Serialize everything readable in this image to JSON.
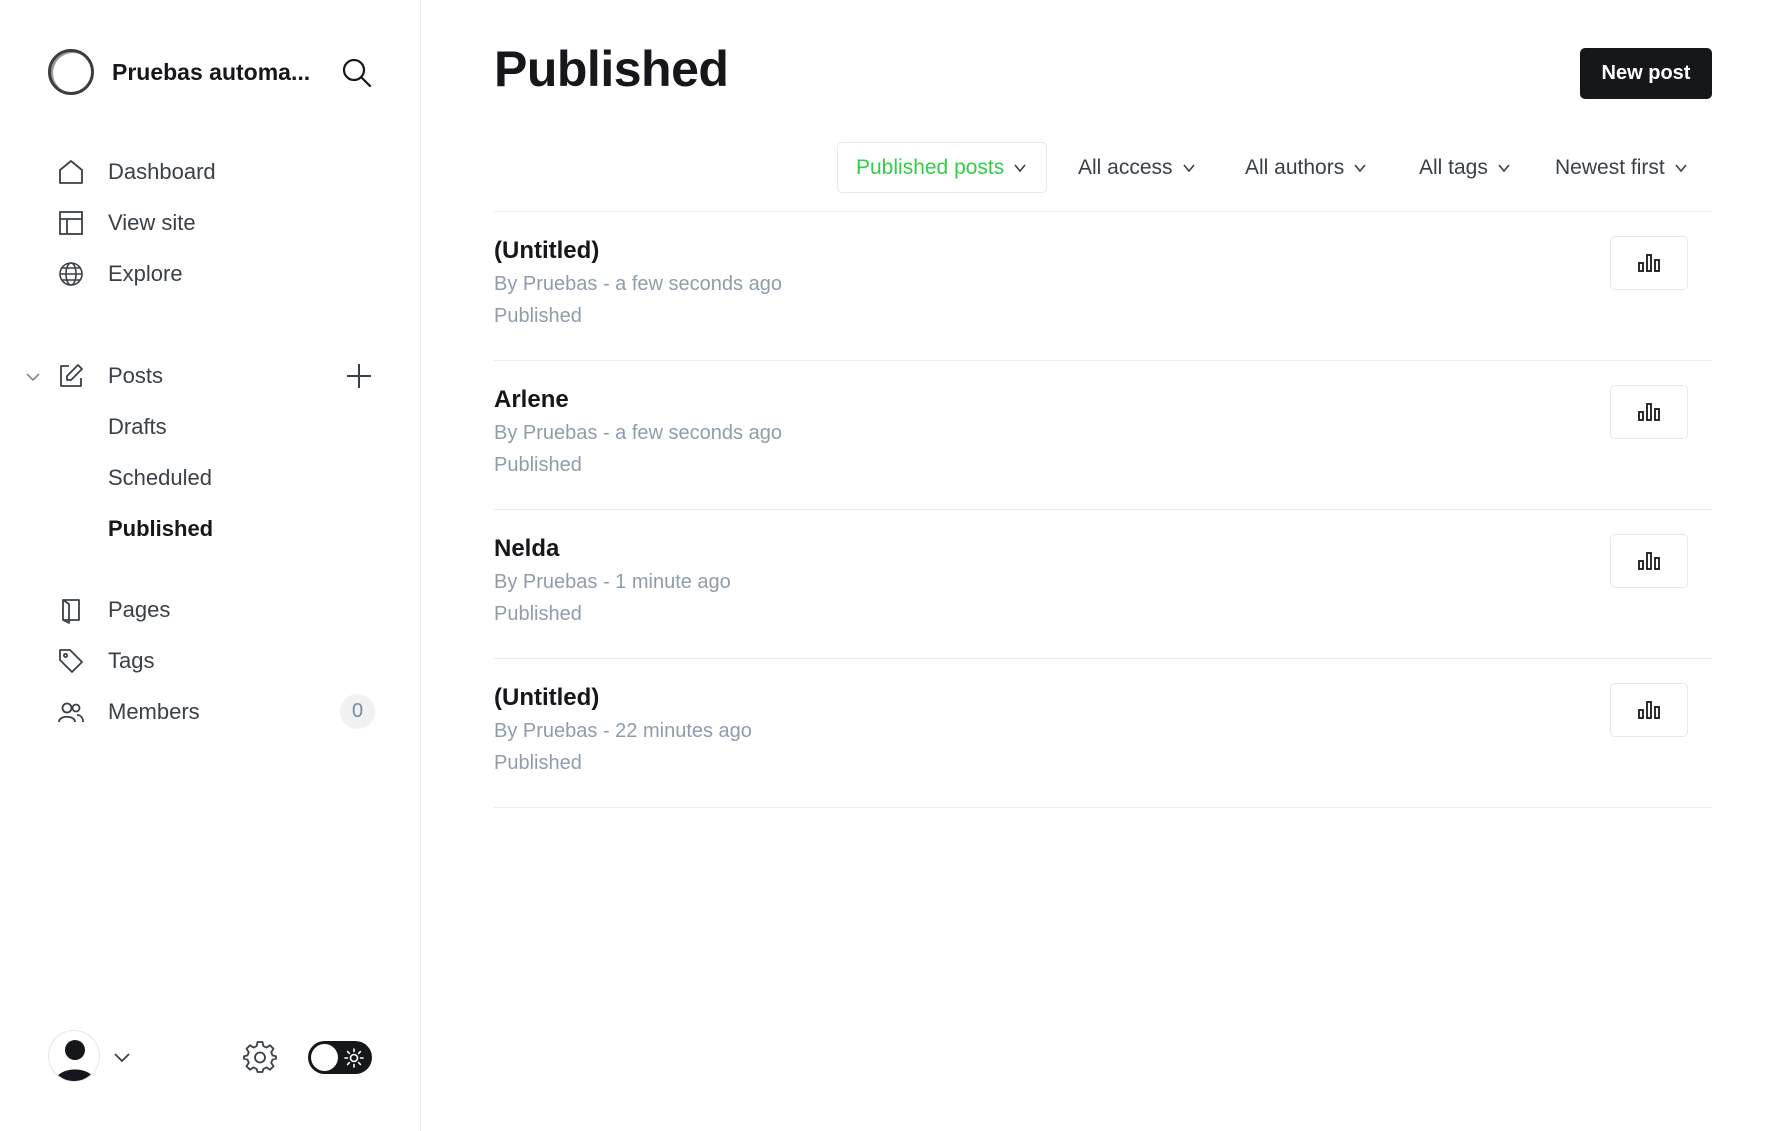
{
  "sidebar": {
    "site_title": "Pruebas automa...",
    "nav": {
      "dashboard": "Dashboard",
      "view_site": "View site",
      "explore": "Explore",
      "posts": "Posts",
      "drafts": "Drafts",
      "scheduled": "Scheduled",
      "published": "Published",
      "pages": "Pages",
      "tags": "Tags",
      "members": "Members",
      "members_count": "0"
    }
  },
  "main": {
    "title": "Published",
    "new_post_label": "New post",
    "filters": {
      "type": "Published posts",
      "access": "All access",
      "authors": "All authors",
      "tags": "All tags",
      "order": "Newest first"
    },
    "posts": [
      {
        "title": "(Untitled)",
        "meta": "By Pruebas - a few seconds ago",
        "status": "Published"
      },
      {
        "title": "Arlene",
        "meta": "By Pruebas - a few seconds ago",
        "status": "Published"
      },
      {
        "title": "Nelda",
        "meta": "By Pruebas - 1 minute ago",
        "status": "Published"
      },
      {
        "title": "(Untitled)",
        "meta": "By Pruebas - 22 minutes ago",
        "status": "Published"
      }
    ]
  },
  "colors": {
    "accent_green": "#30cf43",
    "primary_dark": "#15171a",
    "muted_text": "#8e9cac"
  },
  "icons": {
    "search": "search-icon",
    "dashboard": "home-icon",
    "view_site": "layout-icon",
    "explore": "globe-icon",
    "posts": "pencil-icon",
    "pages": "page-icon",
    "tags": "tag-icon",
    "members": "members-icon",
    "stats": "bar-chart-icon",
    "settings": "gear-icon",
    "theme": "sun-icon"
  }
}
